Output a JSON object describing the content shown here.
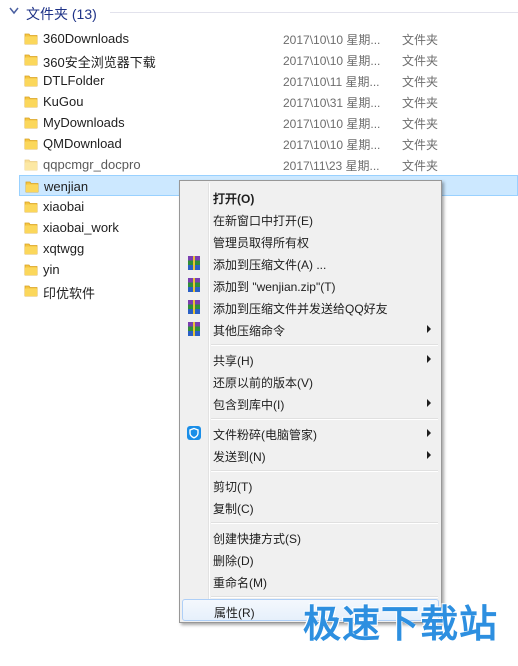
{
  "group": {
    "title": "文件夹 (13)"
  },
  "files": [
    {
      "name": "360Downloads",
      "date": "2017\\10\\10 星期...",
      "type": "文件夹"
    },
    {
      "name": "360安全浏览器下载",
      "date": "2017\\10\\10 星期...",
      "type": "文件夹"
    },
    {
      "name": "DTLFolder",
      "date": "2017\\10\\11 星期...",
      "type": "文件夹"
    },
    {
      "name": "KuGou",
      "date": "2017\\10\\31 星期...",
      "type": "文件夹"
    },
    {
      "name": "MyDownloads",
      "date": "2017\\10\\10 星期...",
      "type": "文件夹"
    },
    {
      "name": "QMDownload",
      "date": "2017\\10\\10 星期...",
      "type": "文件夹"
    },
    {
      "name": "qqpcmgr_docpro",
      "date": "2017\\11\\23 星期...",
      "type": "文件夹"
    },
    {
      "name": "wenjian",
      "date": "",
      "type": ""
    },
    {
      "name": "xiaobai",
      "date": "",
      "type": ""
    },
    {
      "name": "xiaobai_work",
      "date": "",
      "type": ""
    },
    {
      "name": "xqtwgg",
      "date": "",
      "type": ""
    },
    {
      "name": "yin",
      "date": "",
      "type": ""
    },
    {
      "name": "印优软件",
      "date": "",
      "type": ""
    }
  ],
  "context_menu": {
    "items": [
      {
        "label": "打开(O)",
        "icon": "",
        "submenu": false
      },
      {
        "label": "在新窗口中打开(E)",
        "icon": "",
        "submenu": false
      },
      {
        "label": "管理员取得所有权",
        "icon": "",
        "submenu": false
      },
      {
        "label": "添加到压缩文件(A) ...",
        "icon": "winrar-icon",
        "submenu": false
      },
      {
        "label": "添加到 \"wenjian.zip\"(T)",
        "icon": "winrar-icon",
        "submenu": false
      },
      {
        "label": "添加到压缩文件并发送给QQ好友",
        "icon": "winrar-icon",
        "submenu": false
      },
      {
        "label": "其他压缩命令",
        "icon": "winrar-icon",
        "submenu": true
      },
      {
        "label": "共享(H)",
        "icon": "",
        "submenu": true
      },
      {
        "label": "还原以前的版本(V)",
        "icon": "",
        "submenu": false
      },
      {
        "label": "包含到库中(I)",
        "icon": "",
        "submenu": true
      },
      {
        "label": "文件粉碎(电脑管家)",
        "icon": "tencent-pc-manager-icon",
        "submenu": true
      },
      {
        "label": "发送到(N)",
        "icon": "",
        "submenu": true
      },
      {
        "label": "剪切(T)",
        "icon": "",
        "submenu": false
      },
      {
        "label": "复制(C)",
        "icon": "",
        "submenu": false
      },
      {
        "label": "创建快捷方式(S)",
        "icon": "",
        "submenu": false
      },
      {
        "label": "删除(D)",
        "icon": "",
        "submenu": false
      },
      {
        "label": "重命名(M)",
        "icon": "",
        "submenu": false
      },
      {
        "label": "属性(R)",
        "icon": "",
        "submenu": false
      }
    ]
  },
  "watermark": "极速下载站",
  "colors": {
    "selection": "#cce8ff",
    "menu_bg": "#f0f0f0",
    "header_text": "#1e3287",
    "watermark": "#2d8fe0"
  }
}
